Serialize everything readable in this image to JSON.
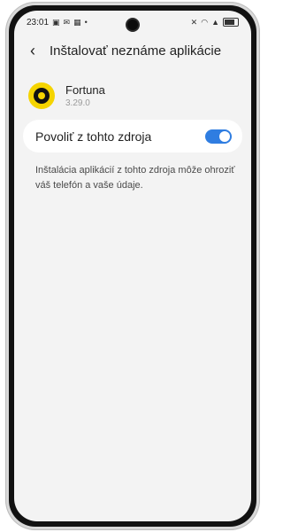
{
  "statusbar": {
    "time": "23:01",
    "left_icons": [
      "gallery-icon",
      "mail-icon",
      "image-icon",
      "dot-icon"
    ],
    "right_icons": [
      "mute-icon",
      "wifi-icon",
      "signal-icon",
      "battery-icon"
    ]
  },
  "header": {
    "back_icon": "back-arrow-icon",
    "title": "Inštalovať neznáme aplikácie"
  },
  "app": {
    "name": "Fortuna",
    "version": "3.29.0",
    "icon": "fortuna-logo-icon",
    "icon_colors": {
      "outer": "#f5d400",
      "inner": "#121212"
    }
  },
  "setting": {
    "label": "Povoliť z tohto zdroja",
    "toggle_on": true,
    "toggle_color": "#2f7de1"
  },
  "description": "Inštalácia aplikácií z tohto zdroja môže ohroziť váš telefón a vaše údaje."
}
